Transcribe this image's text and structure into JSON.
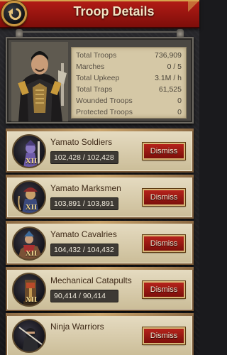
{
  "header": {
    "title": "Troop Details",
    "back_icon": "back-arrow-icon"
  },
  "summary": {
    "portrait": "commander-portrait",
    "stats": [
      {
        "label": "Total Troops",
        "value": "736,909"
      },
      {
        "label": "Marches",
        "value": "0 / 5"
      },
      {
        "label": "Total Upkeep",
        "value": "3.1M / h"
      },
      {
        "label": "Total Traps",
        "value": "61,525"
      },
      {
        "label": "Wounded Troops",
        "value": "0"
      },
      {
        "label": "Protected Troops",
        "value": "0"
      }
    ]
  },
  "troops": [
    {
      "name": "Yamato Soldiers",
      "count": "102,428 / 102,428",
      "tier": "XII",
      "icon": "soldier-icon",
      "dismiss": "Dismiss"
    },
    {
      "name": "Yamato Marksmen",
      "count": "103,891 / 103,891",
      "tier": "XII",
      "icon": "marksman-icon",
      "dismiss": "Dismiss"
    },
    {
      "name": "Yamato Cavalries",
      "count": "104,432 / 104,432",
      "tier": "XII",
      "icon": "cavalry-icon",
      "dismiss": "Dismiss"
    },
    {
      "name": "Mechanical Catapults",
      "count": "90,414 / 90,414",
      "tier": "XII",
      "icon": "catapult-icon",
      "dismiss": "Dismiss"
    },
    {
      "name": "Ninja Warriors",
      "count": "",
      "tier": "",
      "icon": "ninja-icon",
      "dismiss": "Dismiss"
    }
  ]
}
